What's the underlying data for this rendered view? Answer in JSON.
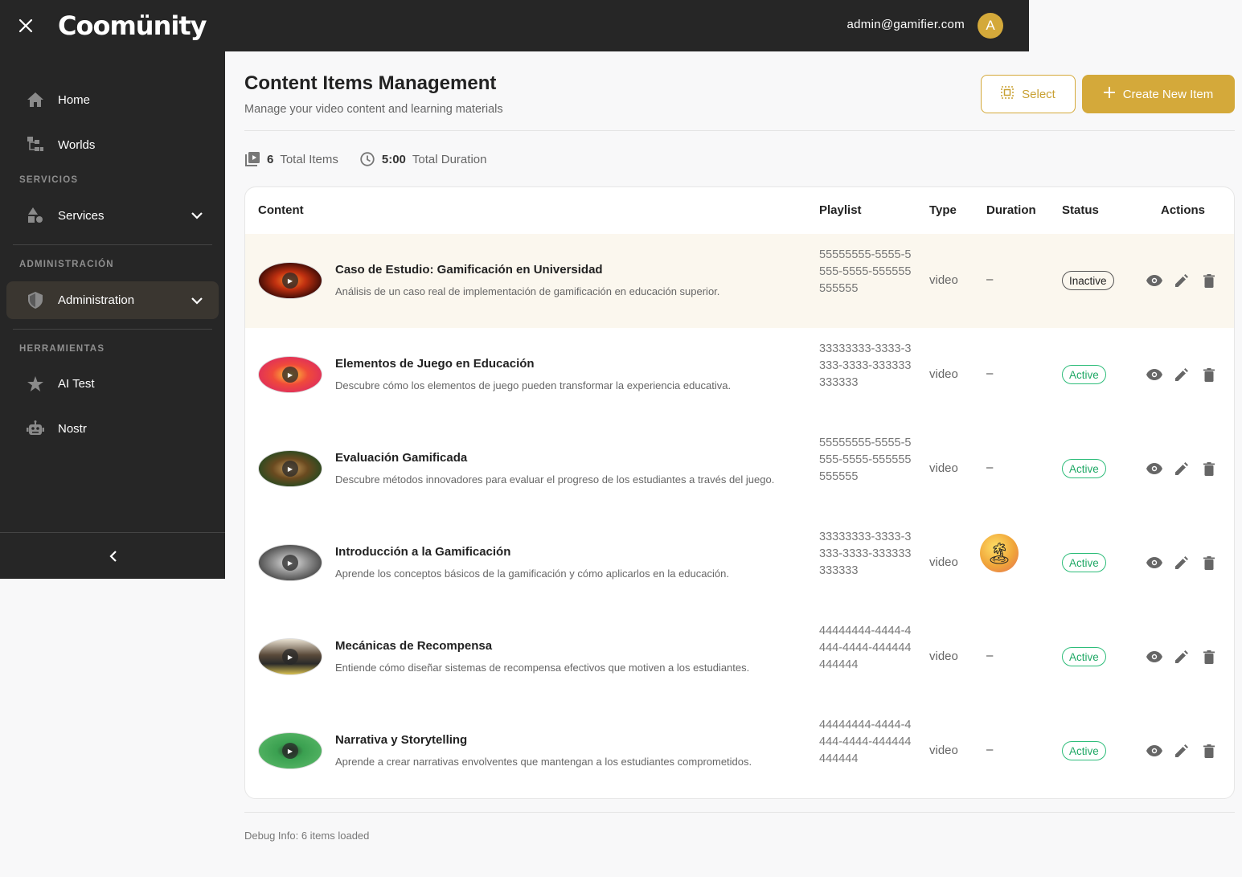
{
  "header": {
    "logo_text": "Coomünity",
    "user_email": "admin@gamifier.com",
    "avatar_initial": "A"
  },
  "sidebar": {
    "items": [
      {
        "label": "Home",
        "icon": "home-icon"
      },
      {
        "label": "Worlds",
        "icon": "worlds-icon"
      },
      {
        "label": "Services",
        "icon": "services-icon"
      },
      {
        "label": "Administration",
        "icon": "shield-icon"
      },
      {
        "label": "AI Test",
        "icon": "star-icon"
      },
      {
        "label": "Nostr",
        "icon": "robot-icon"
      }
    ],
    "sections": {
      "servicios": "SERVICIOS",
      "administracion": "ADMINISTRACIÓN",
      "herramientas": "HERRAMIENTAS"
    }
  },
  "page": {
    "title": "Content Items Management",
    "subtitle": "Manage your video content and learning materials",
    "select_label": "Select",
    "create_label": "Create New Item",
    "stats": {
      "total_items_value": "6",
      "total_items_label": "Total Items",
      "total_duration_value": "5:00",
      "total_duration_label": "Total Duration"
    },
    "debug": "Debug Info: 6 items loaded"
  },
  "table": {
    "headers": [
      "Content",
      "Playlist",
      "Type",
      "Duration",
      "Status",
      "Actions"
    ],
    "rows": [
      {
        "title": "Caso de Estudio: Gamificación en Universidad",
        "desc": "Análisis de un caso real de implementación de gamificación en educación superior.",
        "playlist": "55555555-5555-5555-5555-555555555555",
        "type": "video",
        "duration": "–",
        "status": "Inactive"
      },
      {
        "title": "Elementos de Juego en Educación",
        "desc": "Descubre cómo los elementos de juego pueden transformar la experiencia educativa.",
        "playlist": "33333333-3333-3333-3333-333333333333",
        "type": "video",
        "duration": "–",
        "status": "Active"
      },
      {
        "title": "Evaluación Gamificada",
        "desc": "Descubre métodos innovadores para evaluar el progreso de los estudiantes a través del juego.",
        "playlist": "55555555-5555-5555-5555-555555555555",
        "type": "video",
        "duration": "–",
        "status": "Active"
      },
      {
        "title": "Introducción a la Gamificación",
        "desc": "Aprende los conceptos básicos de la gamificación y cómo aplicarlos en la educación.",
        "playlist": "33333333-3333-3333-3333-333333333333",
        "type": "video",
        "duration": "",
        "status": "Active"
      },
      {
        "title": "Mecánicas de Recompensa",
        "desc": "Entiende cómo diseñar sistemas de recompensa efectivos que motiven a los estudiantes.",
        "playlist": "44444444-4444-4444-4444-444444444444",
        "type": "video",
        "duration": "–",
        "status": "Active"
      },
      {
        "title": "Narrativa y Storytelling",
        "desc": "Aprende a crear narrativas envolventes que mantengan a los estudiantes comprometidos.",
        "playlist": "44444444-4444-4444-4444-444444444444",
        "type": "video",
        "duration": "–",
        "status": "Active"
      }
    ]
  },
  "colors": {
    "accent": "#d4a93a",
    "sidebar_bg": "#262626",
    "active_status": "#1fa865",
    "highlight_row": "#fbf7ee"
  }
}
